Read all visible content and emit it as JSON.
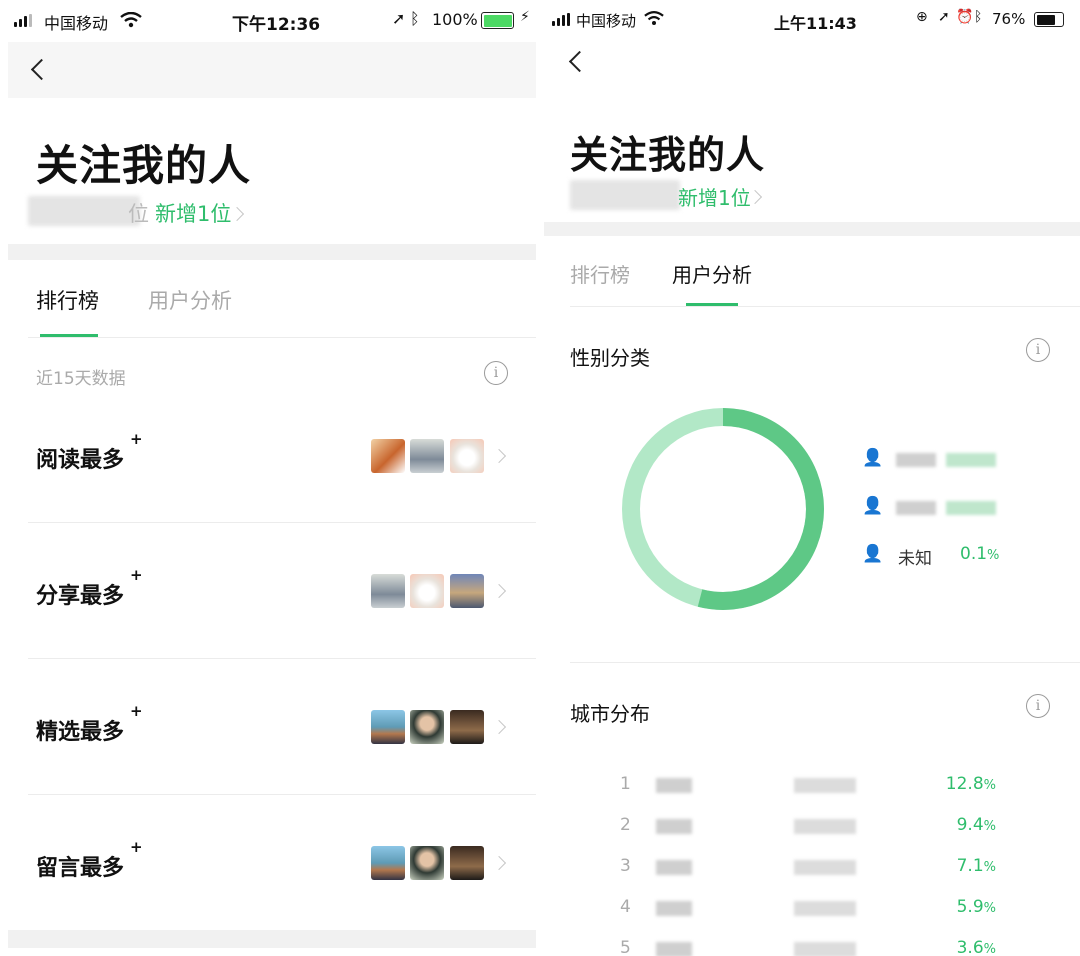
{
  "left": {
    "status": {
      "carrier": "中国移动",
      "time": "下午12:36",
      "battery": "100%",
      "battery_level": 1.0
    },
    "title": "关注我的人",
    "subtitle_suffix": "位",
    "new_followers": "新增1位",
    "tabs": [
      {
        "label": "排行榜",
        "active": true
      },
      {
        "label": "用户分析",
        "active": false
      }
    ],
    "period_label": "近15天数据",
    "rank_items": [
      {
        "label": "阅读最多",
        "sup": "+"
      },
      {
        "label": "分享最多",
        "sup": "+"
      },
      {
        "label": "精选最多",
        "sup": "+"
      },
      {
        "label": "留言最多",
        "sup": "+"
      }
    ]
  },
  "right": {
    "status": {
      "carrier": "中国移动",
      "time": "上午11:43",
      "battery": "76%",
      "battery_level": 0.76
    },
    "title": "关注我的人",
    "new_followers": "新增1位",
    "tabs": [
      {
        "label": "排行榜",
        "active": false
      },
      {
        "label": "用户分析",
        "active": true
      }
    ],
    "gender_section": {
      "title": "性别分类",
      "legend": [
        {
          "label": "",
          "percent": ""
        },
        {
          "label": "",
          "percent": ""
        },
        {
          "label": "未知",
          "percent": "0.1",
          "unit": "%"
        }
      ]
    },
    "city_section": {
      "title": "城市分布",
      "rows": [
        {
          "rank": "1",
          "percent": "12.8",
          "unit": "%"
        },
        {
          "rank": "2",
          "percent": "9.4",
          "unit": "%"
        },
        {
          "rank": "3",
          "percent": "7.1",
          "unit": "%"
        },
        {
          "rank": "4",
          "percent": "5.9",
          "unit": "%"
        },
        {
          "rank": "5",
          "percent": "3.6",
          "unit": "%"
        }
      ]
    }
  },
  "colors": {
    "accent": "#1aad19",
    "link_green": "#2fbd6c",
    "chart_dark": "#5ec886",
    "chart_light": "#b2e8c7",
    "muted": "#9b9b9b"
  }
}
